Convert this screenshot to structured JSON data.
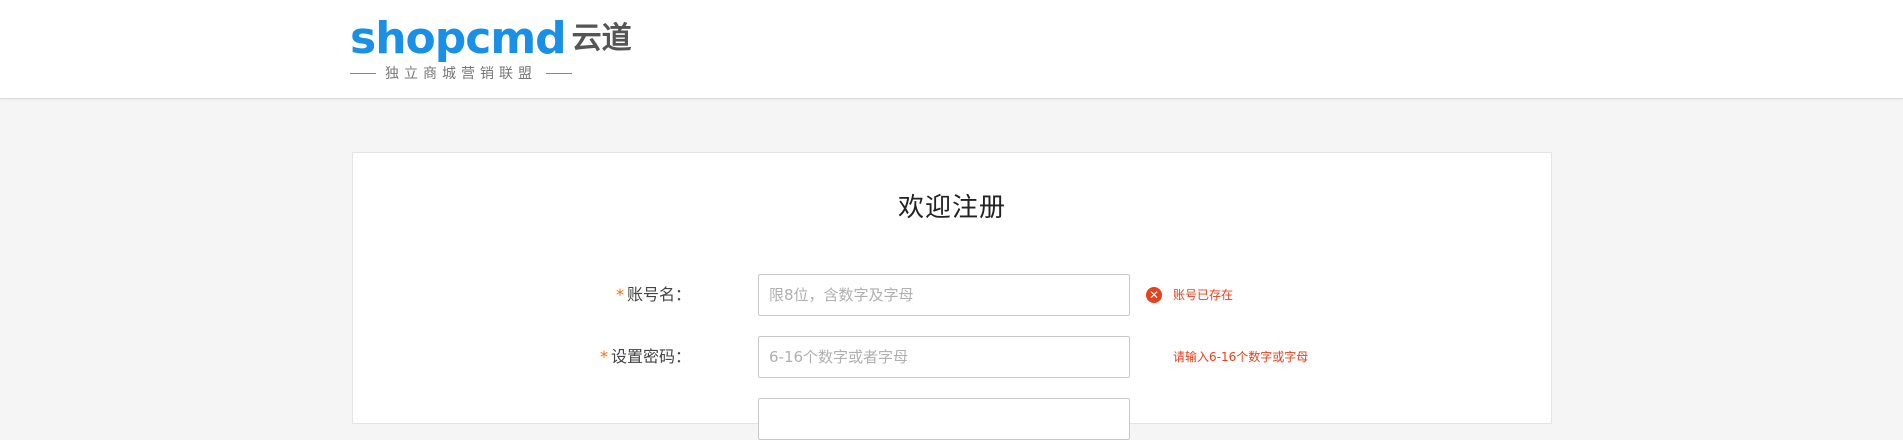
{
  "header": {
    "logo_word": "shopcmd",
    "logo_cn": "云道",
    "logo_tagline": "独立商城营销联盟"
  },
  "form": {
    "title": "欢迎注册",
    "required_mark": "*",
    "fields": [
      {
        "label": "账号名：",
        "value": "",
        "placeholder": "限8位，含数字及字母",
        "error": "账号已存在",
        "error_icon": "error-circle-icon"
      },
      {
        "label": "设置密码：",
        "value": "",
        "placeholder": "6-16个数字或者字母",
        "error": "请输入6-16个数字或字母"
      },
      {
        "value": ""
      }
    ]
  },
  "colors": {
    "brand": "#1a8fe6",
    "required": "#ff6a00",
    "error": "#e8401c",
    "page_bg": "#f5f5f5"
  }
}
